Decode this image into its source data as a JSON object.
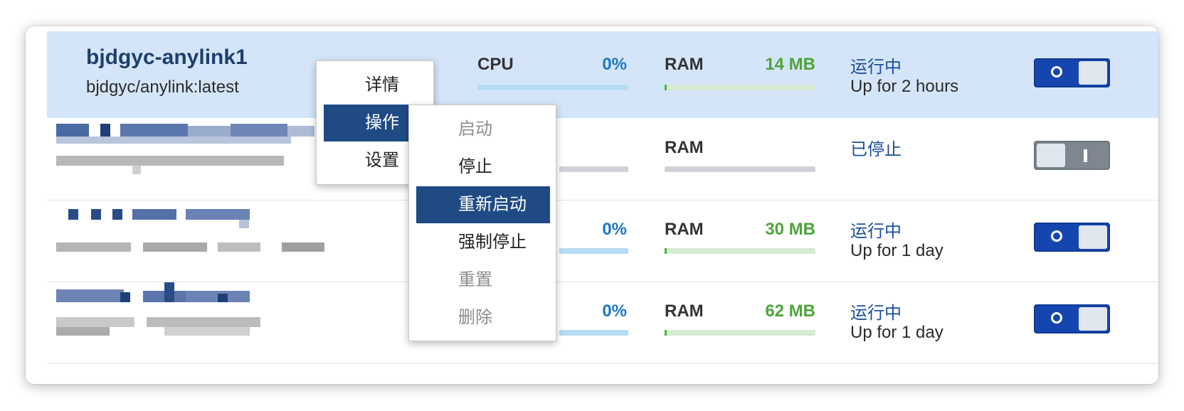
{
  "containers": [
    {
      "name": "bjdgyc-anylink1",
      "image": "bjdgyc/anylink:latest",
      "cpu_label": "CPU",
      "cpu_value": "0%",
      "ram_label": "RAM",
      "ram_value": "14 MB",
      "status": "运行中",
      "uptime": "Up for 2 hours",
      "enabled": true,
      "selected": true
    },
    {
      "ram_label": "RAM",
      "status": "已停止",
      "enabled": false
    },
    {
      "cpu_value": "0%",
      "ram_label": "RAM",
      "ram_value": "30 MB",
      "status": "运行中",
      "uptime": "Up for 1 day",
      "enabled": true
    },
    {
      "cpu_value": "0%",
      "ram_label": "RAM",
      "ram_value": "62 MB",
      "status": "运行中",
      "uptime": "Up for 1 day",
      "enabled": true
    }
  ],
  "context_menu": {
    "items": [
      {
        "label": "详情",
        "submenu": false
      },
      {
        "label": "操作",
        "submenu": true,
        "highlighted": true
      },
      {
        "label": "设置",
        "submenu": true
      }
    ]
  },
  "submenu": {
    "items": [
      {
        "label": "启动",
        "disabled": true
      },
      {
        "label": "停止",
        "disabled": false
      },
      {
        "label": "重新启动",
        "disabled": false,
        "highlighted": true
      },
      {
        "label": "强制停止",
        "disabled": false
      },
      {
        "label": "重置",
        "disabled": true
      },
      {
        "label": "删除",
        "disabled": true
      }
    ]
  },
  "colors": {
    "selected_row": "#d5e5f9",
    "cpu_value": "#1c78c0",
    "ram_value": "#4ea53a",
    "status": "#1a4f9c",
    "toggle_on": "#1546b0",
    "menu_highlight": "#1f4a84"
  }
}
